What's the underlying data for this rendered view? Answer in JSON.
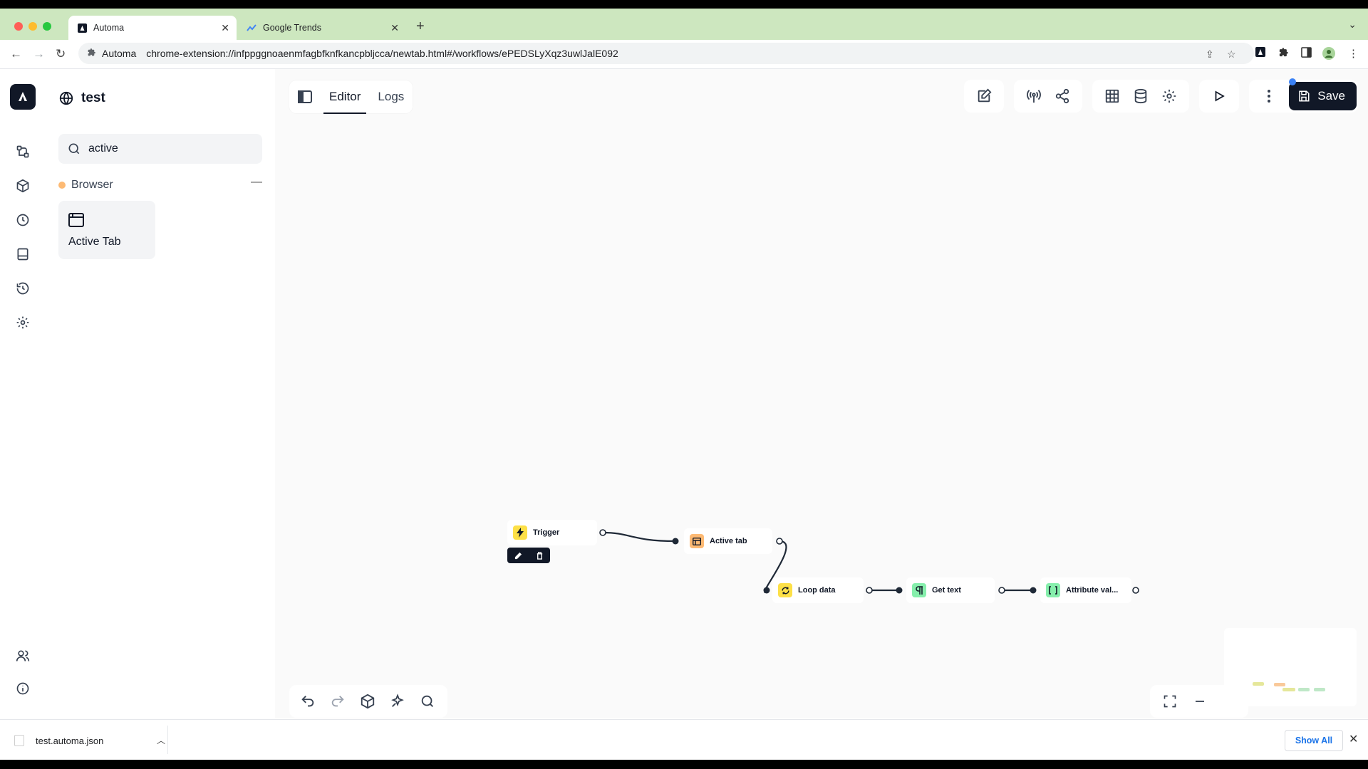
{
  "browser": {
    "tabs": [
      {
        "title": "Automa",
        "active": true
      },
      {
        "title": "Google Trends",
        "active": false
      }
    ],
    "new_tab": "+",
    "address": {
      "site_name": "Automa",
      "url": "chrome-extension://infppggnoaenmfagbfknfkancpbljcca/newtab.html#/workflows/ePEDSLyXqz3uwlJalE092"
    }
  },
  "sidebar": {
    "workflow_name": "test",
    "search": {
      "value": "active",
      "placeholder": "Search..."
    },
    "category": {
      "name": "Browser",
      "collapse": "—"
    },
    "blocks": [
      {
        "label": "Active Tab"
      }
    ]
  },
  "editor": {
    "tabs": [
      {
        "label": "Editor",
        "active": true
      },
      {
        "label": "Logs",
        "active": false
      }
    ],
    "save_label": "Save",
    "nodes": [
      {
        "label": "Trigger",
        "icon": "lightning-icon",
        "color": "#fde047"
      },
      {
        "label": "Active tab",
        "icon": "window-icon",
        "color": "#fdba74"
      },
      {
        "label": "Loop data",
        "icon": "loop-icon",
        "color": "#fde047"
      },
      {
        "label": "Get text",
        "icon": "paragraph-icon",
        "color": "#86efac"
      },
      {
        "label": "Attribute val...",
        "icon": "brackets-icon",
        "color": "#86efac"
      }
    ]
  },
  "downloads": {
    "file_name": "test.automa.json",
    "show_all": "Show All"
  },
  "colors": {
    "tabstrip": "#cde7bf",
    "primary_dark": "#111827",
    "accent_blue": "#3b82f6"
  }
}
